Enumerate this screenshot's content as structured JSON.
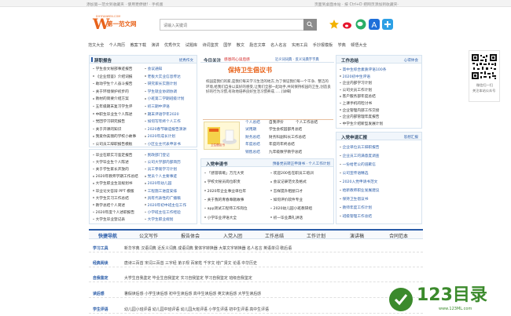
{
  "topbar": {
    "left": "添加第一范文到收藏夹 · 使用更便捷!   · 手机版",
    "right": "页面到桌面本站  ·  按 Ctrl+D 把网页添加到收藏夹·"
  },
  "logo": {
    "sub": "DIYIFANWEN.COM",
    "cn": "第一范文网"
  },
  "search": {
    "placeholder": "请输入关键词"
  },
  "nav": [
    "范文大全",
    "个人简历",
    "教案下载",
    "演讲",
    "优秀作文",
    "试题库",
    "诗词鉴赏",
    "国学",
    "散文",
    "励志文章",
    "名人名言",
    "实用工具",
    "手抄报模板",
    "学典",
    "顿悟大全"
  ],
  "left_box1": {
    "title": "辞职报告",
    "more": "优秀作文",
    "items": [
      [
        "学生会文秘部事迹报告",
        "会议通知",
        "新闻稿"
      ],
      [
        "《企业借鉴》介绍词报",
        "老板大实业信息传达"
      ],
      [
        "助动学生个人奋斗报告",
        "研究家长实施计划"
      ],
      [
        "关于环境保护初步的",
        "学生就业协调协调"
      ],
      [
        "教材的简要介绍方案",
        "小班第二学期班级计划"
      ],
      [
        "五年级期末复习学生评",
        "初三期中评语"
      ],
      [
        "中职生毕业生个人陈述",
        "期末评语学年2020"
      ],
      [
        "党团学习研究报告",
        "如何写年终个人工作"
      ],
      [
        "关于开课的知识",
        "2020春节联谊报告演讲"
      ],
      [
        "我爱你美丽的学校小故事",
        "2020年成长计划"
      ],
      [
        "公司员工辞职报告模板",
        "小区业主代表申诉书"
      ]
    ]
  },
  "left_box2": {
    "items": [
      [
        "毕业在职实习鉴定报告",
        "民政部门登记"
      ],
      [
        "大学毕业生个人陈述",
        "公司大学部内部简历"
      ],
      [
        "关于学生家长开放的",
        "员工参观学习计划"
      ],
      [
        "2020年教师学期工作总结",
        "党员个人主要事迹"
      ],
      [
        "大学生职业生涯规划书",
        "2020年幼儿园"
      ],
      [
        "毕业论文答辩 PPT 模版",
        "工程施工进度安排"
      ],
      [
        "大学生实习工作总结",
        "具有代表性的广播稿"
      ],
      [
        "教学总结个人简述",
        "2020年初中班主任工作"
      ],
      [
        "2020年度个人述职报告",
        "小学班主任工作经验"
      ],
      [
        "大学生毕业登记表",
        "大学生职业规划"
      ]
    ]
  },
  "center": {
    "today_label": "今日关注",
    "today_link": "感恩的心读后感",
    "today_extra": "近义词词典 · 反义词典字字典",
    "headline": "保持卫生倡议书",
    "para": "校园是我们的家,是我们每天学习生活的地方,为了保证我们每一个干净、整洁的环境,给我们自身以美好的感受,让我们全部一起动手,共同保持校园的卫生,创造良好的行为习惯,有效地培养良好生活习惯养成……[详细]",
    "thumb_label": "卫生倡议书",
    "list": [
      [
        "个人总结",
        "自我评价",
        "个人工作总结"
      ],
      [
        "试用期",
        "学生会校园部月总结"
      ],
      [
        "财务总结",
        "财务科副科长工作总结"
      ],
      [
        "年度总结",
        "年度的年终总结"
      ],
      [
        "销售总结",
        "九年级数学教学总结"
      ]
    ]
  },
  "center2": {
    "title": "入党申请书",
    "more": "预备党员转正申请书 · 个人工作计划",
    "items": [
      [
        "「感冒咳嗽」万元大奖",
        "欢迎200名在职员工培训"
      ],
      [
        "学校文秘员岗位职责",
        "会议记录范文及格式"
      ],
      [
        "2020年企业事业单位年",
        "怎样提升租屋口才"
      ],
      [
        "关于我的青春奉献故事",
        "如何评价软件专业"
      ],
      [
        "app测试工程师工作岗位",
        "2020幼儿园小班教研组"
      ],
      [
        "小学毕业评语大全",
        "初一毕业典礼讲话"
      ]
    ]
  },
  "right_box1": {
    "title": "工作总结",
    "more": "心得体会",
    "items": [
      "高中生综合素质评语100条",
      "2020初中生评语",
      "企业内部学习计划",
      "公司文员工作计划",
      "客户服务部年度总结",
      "上课手机的检讨书",
      "企业管理内部工作交接",
      "企业内部管理年度报告",
      "中学生介绍新型发展计划"
    ]
  },
  "right_box2": {
    "title": "入党申请汇报",
    "more": "思想汇报",
    "items": [
      "企业单位员工辞职报告",
      "企业员工的满意度调查",
      "一份给老公的道歉信",
      "公司宣传语精选",
      "2020入党申请书范文",
      "给新教师职业发展建议",
      "保持卫生倡议书",
      "教师年度工作计划",
      "班级管理工作总结"
    ]
  },
  "qr": {
    "caption1": "微信扫一扫",
    "caption2": "关注本站公众号"
  },
  "tabs": [
    "快捷导航",
    "公文写作",
    "报告体会",
    "入党入团",
    "工作总结",
    "工作计划",
    "演讲稿",
    "合同范本"
  ],
  "grid_rows": [
    [
      "学习工具",
      "新华字典  汉语词典  近反义词典  成语词典  繁体字转换器  大篆文字转换器  名人名言  英语单词  歇后语"
    ],
    [
      "经典阅读",
      "唐诗三百首  宋词三百首  三字经  弟子规  百家姓  千字文  增广贤文  论语  中华历史"
    ],
    [
      "自我鉴定",
      "大学生自我鉴定  毕业生自我鉴定  实习自我鉴定  学习自我鉴定  班级自我鉴定"
    ],
    [
      "读后感",
      "暑假读后感  小学生读后感  初中生读后感  高中生读后感  英文读后感  大学生读后感"
    ],
    [
      "学生评语",
      "幼儿园小班评语  幼儿园中班评语  幼儿园大班评语  小学生评语  初中生评语  高中生评语"
    ]
  ],
  "watermark": {
    "text": "123目录",
    "url": "www.123ML.com"
  },
  "colors": {
    "accent": "#e8631b",
    "link": "#2a5ca8",
    "border": "#d6e3ef"
  }
}
